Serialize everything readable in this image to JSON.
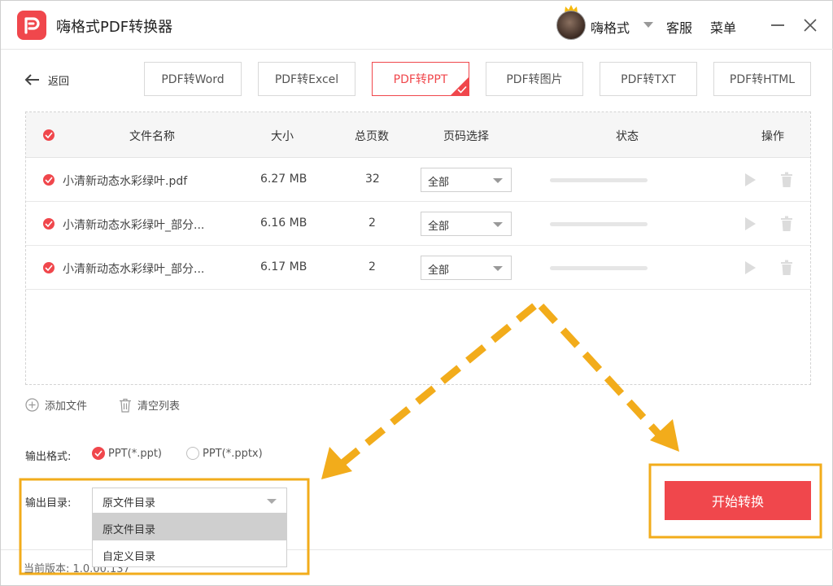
{
  "app": {
    "title": "嗨格式PDF转换器",
    "user_name": "嗨格式",
    "service_label": "客服",
    "menu_label": "菜单"
  },
  "nav": {
    "back_label": "返回",
    "tabs": [
      {
        "label": "PDF转Word",
        "active": false
      },
      {
        "label": "PDF转Excel",
        "active": false
      },
      {
        "label": "PDF转PPT",
        "active": true
      },
      {
        "label": "PDF转图片",
        "active": false
      },
      {
        "label": "PDF转TXT",
        "active": false
      },
      {
        "label": "PDF转HTML",
        "active": false
      }
    ]
  },
  "table": {
    "headers": {
      "name": "文件名称",
      "size": "大小",
      "pages": "总页数",
      "page_select": "页码选择",
      "status": "状态",
      "actions": "操作"
    },
    "rows": [
      {
        "name": "小清新动态水彩绿叶.pdf",
        "size": "6.27 MB",
        "pages": "32",
        "page_select": "全部",
        "progress": 0
      },
      {
        "name": "小清新动态水彩绿叶_部分...",
        "size": "6.16 MB",
        "pages": "2",
        "page_select": "全部",
        "progress": 0
      },
      {
        "name": "小清新动态水彩绿叶_部分...",
        "size": "6.17 MB",
        "pages": "2",
        "page_select": "全部",
        "progress": 0
      }
    ]
  },
  "tools": {
    "add_label": "添加文件",
    "clear_label": "清空列表"
  },
  "output_format": {
    "label": "输出格式:",
    "options": [
      {
        "label": "PPT(*.ppt)",
        "selected": true
      },
      {
        "label": "PPT(*.pptx)",
        "selected": false
      }
    ]
  },
  "output_dir": {
    "label": "输出目录:",
    "value": "原文件目录",
    "options": [
      "原文件目录",
      "自定义目录"
    ]
  },
  "footer": {
    "version": "当前版本: 1.0.00.137"
  },
  "start_button": "开始转换",
  "colors": {
    "accent": "#f0474c",
    "annotation": "#f2ac1b"
  }
}
